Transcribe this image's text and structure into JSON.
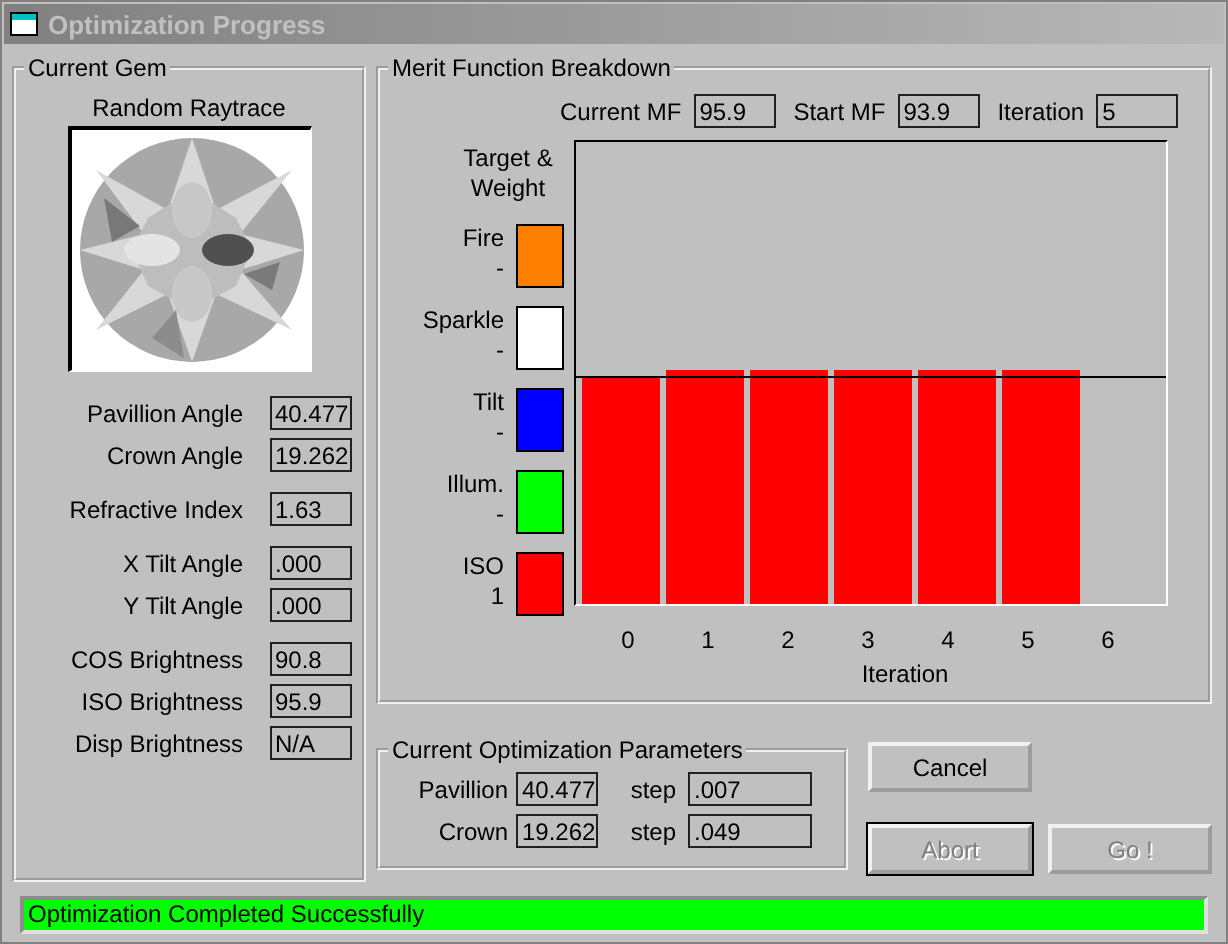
{
  "window": {
    "title": "Optimization Progress"
  },
  "current_gem": {
    "title": "Current Gem",
    "image_caption": "Random Raytrace",
    "field_groups": [
      [
        {
          "label": "Pavillion Angle",
          "value": "40.477"
        },
        {
          "label": "Crown Angle",
          "value": "19.262"
        }
      ],
      [
        {
          "label": "Refractive Index",
          "value": "1.63"
        }
      ],
      [
        {
          "label": "X Tilt Angle",
          "value": ".000"
        },
        {
          "label": "Y Tilt Angle",
          "value": ".000"
        }
      ],
      [
        {
          "label": "COS Brightness",
          "value": "90.8"
        },
        {
          "label": "ISO Brightness",
          "value": "95.9"
        },
        {
          "label": "Disp Brightness",
          "value": "N/A"
        }
      ]
    ]
  },
  "merit": {
    "title": "Merit Function Breakdown",
    "stats": [
      {
        "label": "Current MF",
        "value": "95.9"
      },
      {
        "label": "Start MF",
        "value": "93.9"
      },
      {
        "label": "Iteration",
        "value": "5"
      }
    ],
    "legend_title": "Target & Weight",
    "targets": [
      {
        "name": "Fire",
        "weight": "-",
        "color": "#ff8000"
      },
      {
        "name": "Sparkle",
        "weight": "-",
        "color": "#ffffff"
      },
      {
        "name": "Tilt",
        "weight": "-",
        "color": "#0000ff"
      },
      {
        "name": "Illum.",
        "weight": "-",
        "color": "#00ff00"
      },
      {
        "name": "ISO",
        "weight": "1",
        "color": "#ff0000"
      }
    ],
    "chart": {
      "x_ticks": [
        "0",
        "1",
        "2",
        "3",
        "4",
        "5",
        "6"
      ],
      "xlabel": "Iteration"
    }
  },
  "parameters": {
    "title": "Current Optimization Parameters",
    "rows": [
      {
        "label": "Pavillion",
        "value": "40.477",
        "step_label": "step",
        "step_value": ".007"
      },
      {
        "label": "Crown",
        "value": "19.262",
        "step_label": "step",
        "step_value": ".049"
      }
    ]
  },
  "buttons": [
    {
      "label": "Cancel",
      "disabled": false
    },
    {
      "label": "Abort",
      "disabled": true
    },
    {
      "label": "Go !",
      "disabled": true
    }
  ],
  "status_bar": {
    "text": "Optimization Completed Successfully"
  }
}
